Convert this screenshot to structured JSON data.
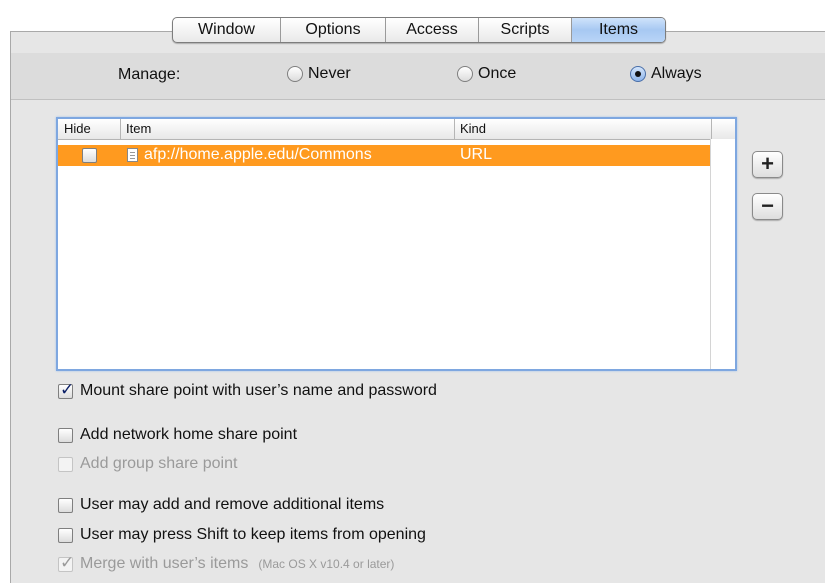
{
  "tabs": [
    {
      "label": "Window",
      "selected": false
    },
    {
      "label": "Options",
      "selected": false
    },
    {
      "label": "Access",
      "selected": false
    },
    {
      "label": "Scripts",
      "selected": false
    },
    {
      "label": "Items",
      "selected": true
    }
  ],
  "manage": {
    "label": "Manage:",
    "options": [
      {
        "label": "Never",
        "selected": false
      },
      {
        "label": "Once",
        "selected": false
      },
      {
        "label": "Always",
        "selected": true
      }
    ]
  },
  "items_table": {
    "columns": [
      "Hide",
      "Item",
      "Kind"
    ],
    "rows": [
      {
        "hide": false,
        "item": "afp://home.apple.edu/Commons",
        "kind": "URL",
        "selected": true,
        "icon": "document-icon"
      }
    ]
  },
  "buttons": {
    "add": "+",
    "remove": "−"
  },
  "options": {
    "mount": {
      "label": "Mount share point with user’s name and password",
      "checked": true,
      "enabled": true
    },
    "add_home": {
      "label": "Add network home share point",
      "checked": false,
      "enabled": true
    },
    "add_group": {
      "label": "Add group share point",
      "checked": false,
      "enabled": false
    },
    "user_add_remove": {
      "label": "User may add and remove additional items",
      "checked": false,
      "enabled": true
    },
    "shift_keep": {
      "label": "User may press Shift to keep items from opening",
      "checked": false,
      "enabled": true
    },
    "merge": {
      "label": "Merge with user’s items",
      "note": "(Mac OS X v10.4 or later)",
      "checked": true,
      "enabled": false
    }
  },
  "colors": {
    "selection": "#ff9a1f",
    "tab_selected": "#a7c8f2",
    "focus_ring": "#7ea7e0"
  }
}
